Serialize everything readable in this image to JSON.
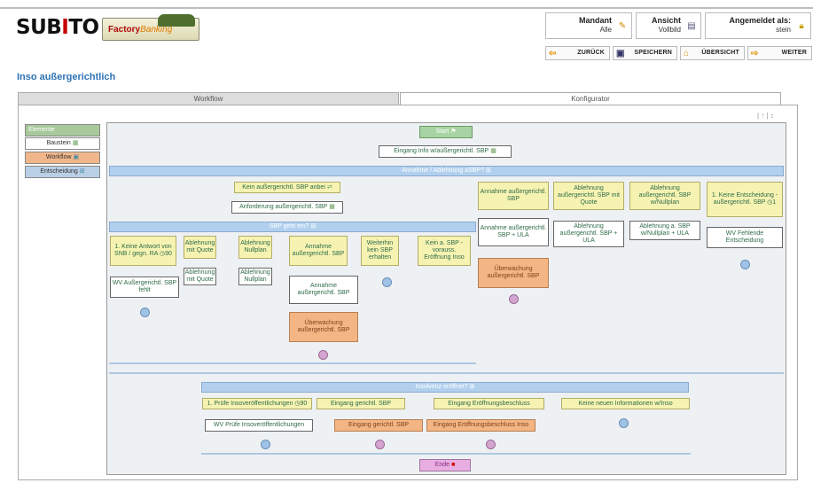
{
  "header": {
    "logo": {
      "left": "SUB",
      "mid": "I",
      "right": "TO"
    },
    "factory": {
      "a": "Factory",
      "b": "Banking"
    },
    "mandant": {
      "label": "Mandant",
      "value": "Alle"
    },
    "ansicht": {
      "label": "Ansicht",
      "value": "Vollbild"
    },
    "user": {
      "label": "Angemeldet als:",
      "value": "stein"
    }
  },
  "nav": {
    "back": "ZURÜCK",
    "save": "SPEICHERN",
    "overview": "ÜBERSICHT",
    "next": "WEITER"
  },
  "page": {
    "title": "Inso außergerichtlich"
  },
  "tabs": {
    "workflow": "Workflow",
    "konfigurator": "Konfigurator"
  },
  "tools": "| ↑ | ↕",
  "legend": {
    "header": "Elemente",
    "items": [
      "Baustein",
      "Workflow",
      "Entscheidung"
    ]
  },
  "flow": {
    "start": "Start",
    "eingang_info": "Eingang Info w/außergerichtl. SBP",
    "annahme_ablehnung": "Annahme / Ablehnung aSBP?",
    "kein_sbp": "Kein außergerichtl. SBP anbei",
    "anforderung": "Anforderung außergerichtl. SBP",
    "sbp_geht_ein": "SBP geht ein?",
    "c1a": "1. Keine Antwort von SNB / gegn. RA",
    "c1b": "90",
    "c2": "Ablehnung mit Quote",
    "c3": "Ablehnung Nullplan",
    "c4": "Annahme außergerichtl. SBP",
    "c5": "Weiterhin kein SBP erhalten",
    "c6": "Kein a. SBP - vorauss. Eröffnung Inso",
    "w1": "WV Außergerichtl. SBP fehlt",
    "w2": "Ablehnung mit Quote",
    "w3": "Ablehnung Nullplan",
    "w4": "Annahme außergerichtl. SBP",
    "o1": "Überwachung außergerichtl. SBP",
    "r1": "Annahme außergerichtl. SBP",
    "r2": "Ablehnung außergerichtl. SBP mit Quote",
    "r3": "Ablehnung außergerichtl. SBP w/Nullplan",
    "r4": "1. Keine Entscheidung - außergerichtl. SBP",
    "r4b": "1",
    "rw1": "Annahme außergerichtl. SBP + ULA",
    "rw2": "Ablehnung außergerichtl. SBP + ULA",
    "rw3": "Ablehnung a. SBP w/Nullplan + ULA",
    "rw4": "WV Fehlende Entscheidung",
    "ro1": "Überwachung außergerichtl. SBP",
    "insolvenz": "Insolvenz eröffnet?",
    "i1": "1. Prüfe Insoveröffentlichungen",
    "i1b": "90",
    "i2": "Eingang gerichtl. SBP",
    "i3": "Eingang Eröffnungsbeschluss",
    "i4": "Keine neuen Informationen w/Inso",
    "iw1": "WV Prüfe Insoveröffentlichungen",
    "io2": "Eingang gerichtl. SBP",
    "io3": "Eingang Eröffnungsbeschluss Inso",
    "ende": "Ende"
  }
}
